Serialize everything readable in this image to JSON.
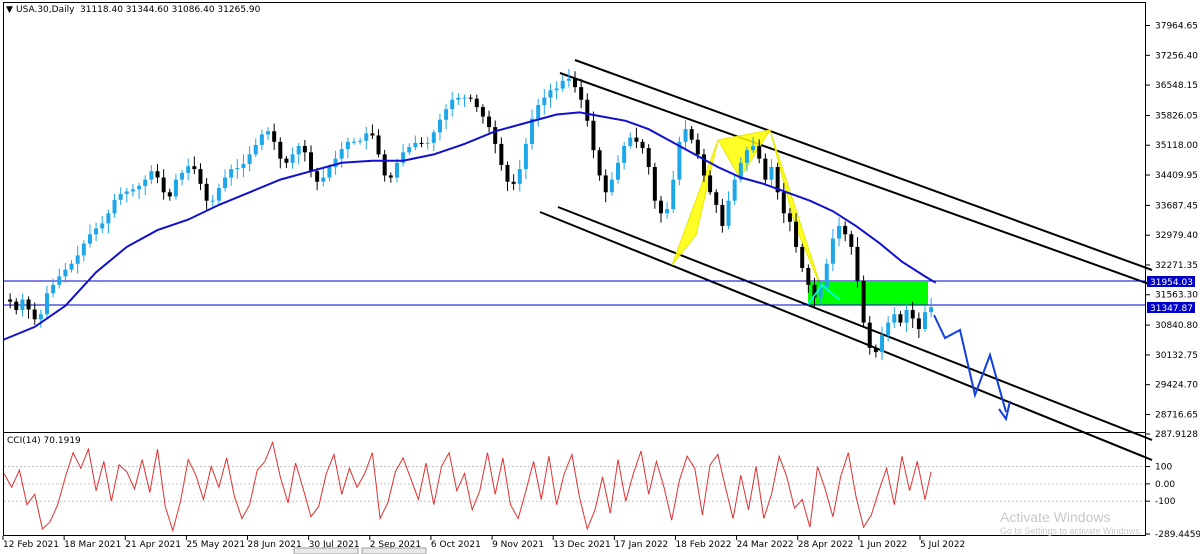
{
  "header": {
    "arrow_glyph": "▼",
    "symbol": "USA.30,Daily",
    "ohlc": "31118.40 31344.60 31086.40 31265.90"
  },
  "watermark": {
    "line1": "Activate Windows",
    "line2": "Go to Settings to activate Windows."
  },
  "colors": {
    "bull": "#1ea7e8",
    "bear": "#000000",
    "ma": "#1010d0",
    "cci": "#e03030",
    "pattern": "#ffff00",
    "zone": "#00ff00",
    "hline": "#0000c8",
    "forecast": "#1040e0",
    "channel": "#000000"
  },
  "chart_data": [
    {
      "type": "candlestick",
      "symbol": "USA.30",
      "timeframe": "Daily",
      "ylim": [
        28300,
        38500
      ],
      "y_ticks": [
        "37964.65",
        "37256.40",
        "36548.15",
        "35826.05",
        "35118.00",
        "34409.95",
        "33687.45",
        "32979.40",
        "32271.35",
        "31563.30",
        "30840.80",
        "30132.75",
        "29424.70",
        "28716.65"
      ],
      "x_ticks": [
        "12 Feb 2021",
        "18 Mar 2021",
        "21 Apr 2021",
        "25 May 2021",
        "28 Jun 2021",
        "30 Jul 2021",
        "2 Sep 2021",
        "6 Oct 2021",
        "9 Nov 2021",
        "13 Dec 2021",
        "17 Jan 2022",
        "18 Feb 2022",
        "24 Mar 2022",
        "28 Apr 2022",
        "1 Jun 2022",
        "5 Jul 2022"
      ],
      "price_path": [
        [
          0,
          31450
        ],
        [
          4,
          31400
        ],
        [
          8,
          31200
        ],
        [
          11,
          31500
        ],
        [
          15,
          31300
        ],
        [
          19,
          30950
        ],
        [
          24,
          31100
        ],
        [
          28,
          31600
        ],
        [
          33,
          31850
        ],
        [
          38,
          32100
        ],
        [
          43,
          32250
        ],
        [
          48,
          32500
        ],
        [
          53,
          32850
        ],
        [
          58,
          33100
        ],
        [
          63,
          33200
        ],
        [
          68,
          33500
        ],
        [
          73,
          33900
        ],
        [
          78,
          34000
        ],
        [
          83,
          34050
        ],
        [
          88,
          34150
        ],
        [
          92,
          34300
        ],
        [
          96,
          34500
        ],
        [
          100,
          34350
        ],
        [
          104,
          34000
        ],
        [
          108,
          33900
        ],
        [
          112,
          34300
        ],
        [
          117,
          34500
        ],
        [
          122,
          34700
        ],
        [
          126,
          34400
        ],
        [
          130,
          34000
        ],
        [
          134,
          33600
        ],
        [
          138,
          34000
        ],
        [
          142,
          34200
        ],
        [
          146,
          34500
        ],
        [
          150,
          34600
        ],
        [
          154,
          34550
        ],
        [
          158,
          34800
        ],
        [
          162,
          35000
        ],
        [
          166,
          35250
        ],
        [
          170,
          35500
        ],
        [
          174,
          35400
        ],
        [
          178,
          35000
        ],
        [
          182,
          34600
        ],
        [
          186,
          34800
        ],
        [
          190,
          35000
        ],
        [
          194,
          35200
        ],
        [
          198,
          34700
        ],
        [
          202,
          34300
        ],
        [
          206,
          34200
        ],
        [
          210,
          34500
        ],
        [
          214,
          34700
        ],
        [
          218,
          34900
        ],
        [
          222,
          35150
        ],
        [
          226,
          35250
        ],
        [
          230,
          35150
        ],
        [
          234,
          35300
        ],
        [
          238,
          35500
        ],
        [
          242,
          35200
        ],
        [
          246,
          34600
        ],
        [
          250,
          34200
        ],
        [
          254,
          34500
        ],
        [
          258,
          34900
        ],
        [
          262,
          35000
        ],
        [
          266,
          35150
        ],
        [
          270,
          35200
        ],
        [
          274,
          35100
        ],
        [
          278,
          35250
        ],
        [
          282,
          35600
        ],
        [
          286,
          35850
        ],
        [
          290,
          36100
        ],
        [
          294,
          36300
        ],
        [
          298,
          36200
        ],
        [
          302,
          36300
        ],
        [
          306,
          36150
        ],
        [
          310,
          35900
        ],
        [
          314,
          35700
        ],
        [
          318,
          35400
        ],
        [
          322,
          34900
        ],
        [
          326,
          34400
        ],
        [
          330,
          34100
        ],
        [
          334,
          34300
        ],
        [
          338,
          34800
        ],
        [
          342,
          35500
        ],
        [
          346,
          36000
        ],
        [
          350,
          36150
        ],
        [
          354,
          36350
        ],
        [
          358,
          36500
        ],
        [
          361,
          36450
        ],
        [
          364,
          36650
        ],
        [
          368,
          36700
        ],
        [
          372,
          36500
        ],
        [
          376,
          36200
        ],
        [
          380,
          35700
        ],
        [
          384,
          35000
        ],
        [
          388,
          34400
        ],
        [
          392,
          34000
        ],
        [
          396,
          34300
        ],
        [
          400,
          34700
        ],
        [
          404,
          35100
        ],
        [
          408,
          35300
        ],
        [
          412,
          35200
        ],
        [
          416,
          35050
        ],
        [
          420,
          34600
        ],
        [
          424,
          33800
        ],
        [
          428,
          33500
        ],
        [
          432,
          33600
        ],
        [
          436,
          34300
        ],
        [
          440,
          35200
        ],
        [
          444,
          35500
        ],
        [
          448,
          35250
        ],
        [
          452,
          34900
        ],
        [
          456,
          34400
        ],
        [
          460,
          34000
        ],
        [
          464,
          33700
        ],
        [
          468,
          33200
        ],
        [
          472,
          33800
        ],
        [
          476,
          34300
        ],
        [
          480,
          34700
        ],
        [
          484,
          35000
        ],
        [
          488,
          35100
        ],
        [
          492,
          34800
        ],
        [
          496,
          34300
        ],
        [
          500,
          34600
        ],
        [
          504,
          34000
        ],
        [
          508,
          33500
        ],
        [
          512,
          33300
        ],
        [
          516,
          32700
        ],
        [
          520,
          32200
        ],
        [
          524,
          31800
        ],
        [
          528,
          31500
        ],
        [
          532,
          31750
        ],
        [
          536,
          32300
        ],
        [
          540,
          32900
        ],
        [
          544,
          33200
        ],
        [
          548,
          33000
        ],
        [
          552,
          32700
        ],
        [
          556,
          31900
        ],
        [
          560,
          30900
        ],
        [
          564,
          30300
        ],
        [
          568,
          30200
        ],
        [
          572,
          30600
        ],
        [
          576,
          30900
        ],
        [
          580,
          31100
        ],
        [
          584,
          30900
        ],
        [
          588,
          31200
        ],
        [
          592,
          31000
        ],
        [
          596,
          30750
        ],
        [
          600,
          31150
        ],
        [
          604,
          31265.9
        ]
      ],
      "candles_step": 4,
      "ma_path": [
        [
          0,
          30500
        ],
        [
          20,
          30800
        ],
        [
          40,
          31300
        ],
        [
          60,
          32100
        ],
        [
          80,
          32700
        ],
        [
          100,
          33100
        ],
        [
          120,
          33350
        ],
        [
          140,
          33700
        ],
        [
          160,
          34000
        ],
        [
          180,
          34300
        ],
        [
          200,
          34500
        ],
        [
          220,
          34700
        ],
        [
          240,
          34750
        ],
        [
          260,
          34750
        ],
        [
          280,
          34900
        ],
        [
          300,
          35150
        ],
        [
          320,
          35450
        ],
        [
          340,
          35650
        ],
        [
          360,
          35850
        ],
        [
          375,
          35900
        ],
        [
          390,
          35800
        ],
        [
          405,
          35700
        ],
        [
          420,
          35500
        ],
        [
          435,
          35200
        ],
        [
          450,
          34900
        ],
        [
          465,
          34600
        ],
        [
          480,
          34350
        ],
        [
          495,
          34200
        ],
        [
          510,
          34000
        ],
        [
          525,
          33800
        ],
        [
          540,
          33550
        ],
        [
          555,
          33200
        ],
        [
          570,
          32800
        ],
        [
          585,
          32350
        ],
        [
          600,
          32000
        ],
        [
          607,
          31850
        ]
      ],
      "cci": {
        "label": "CCI(14) 70.1919",
        "ylim": [
          -289.4459,
          287.9128
        ],
        "y_ticks": [
          "287.9128",
          "100",
          "0.00",
          "-100",
          "-289.4459"
        ],
        "path": [
          [
            0,
            60
          ],
          [
            5,
            -20
          ],
          [
            10,
            80
          ],
          [
            15,
            -120
          ],
          [
            20,
            -60
          ],
          [
            25,
            -260
          ],
          [
            30,
            -220
          ],
          [
            35,
            -120
          ],
          [
            40,
            40
          ],
          [
            45,
            180
          ],
          [
            50,
            90
          ],
          [
            55,
            200
          ],
          [
            60,
            -40
          ],
          [
            65,
            130
          ],
          [
            70,
            -100
          ],
          [
            75,
            110
          ],
          [
            80,
            70
          ],
          [
            85,
            -30
          ],
          [
            90,
            140
          ],
          [
            95,
            -50
          ],
          [
            100,
            200
          ],
          [
            105,
            -130
          ],
          [
            110,
            -270
          ],
          [
            115,
            -100
          ],
          [
            120,
            140
          ],
          [
            125,
            50
          ],
          [
            130,
            -90
          ],
          [
            135,
            100
          ],
          [
            140,
            -20
          ],
          [
            145,
            150
          ],
          [
            150,
            -70
          ],
          [
            155,
            -200
          ],
          [
            160,
            -120
          ],
          [
            165,
            80
          ],
          [
            170,
            130
          ],
          [
            175,
            240
          ],
          [
            180,
            40
          ],
          [
            185,
            -110
          ],
          [
            190,
            120
          ],
          [
            195,
            -30
          ],
          [
            200,
            -190
          ],
          [
            205,
            -130
          ],
          [
            210,
            60
          ],
          [
            215,
            170
          ],
          [
            220,
            -60
          ],
          [
            225,
            90
          ],
          [
            230,
            -20
          ],
          [
            235,
            60
          ],
          [
            240,
            180
          ],
          [
            245,
            -200
          ],
          [
            250,
            -110
          ],
          [
            255,
            70
          ],
          [
            260,
            150
          ],
          [
            265,
            30
          ],
          [
            270,
            -90
          ],
          [
            275,
            120
          ],
          [
            280,
            -120
          ],
          [
            285,
            100
          ],
          [
            290,
            180
          ],
          [
            295,
            -40
          ],
          [
            300,
            60
          ],
          [
            305,
            -150
          ],
          [
            310,
            -40
          ],
          [
            315,
            180
          ],
          [
            320,
            -60
          ],
          [
            325,
            150
          ],
          [
            330,
            -120
          ],
          [
            335,
            -200
          ],
          [
            340,
            -40
          ],
          [
            345,
            130
          ],
          [
            350,
            -90
          ],
          [
            355,
            160
          ],
          [
            360,
            -120
          ],
          [
            365,
            60
          ],
          [
            370,
            170
          ],
          [
            375,
            -80
          ],
          [
            380,
            -260
          ],
          [
            385,
            -150
          ],
          [
            390,
            40
          ],
          [
            395,
            -170
          ],
          [
            400,
            140
          ],
          [
            405,
            -100
          ],
          [
            410,
            60
          ],
          [
            415,
            190
          ],
          [
            420,
            -60
          ],
          [
            425,
            130
          ],
          [
            430,
            -20
          ],
          [
            435,
            -210
          ],
          [
            440,
            20
          ],
          [
            445,
            160
          ],
          [
            450,
            90
          ],
          [
            455,
            -180
          ],
          [
            460,
            110
          ],
          [
            465,
            170
          ],
          [
            470,
            -20
          ],
          [
            475,
            -200
          ],
          [
            480,
            50
          ],
          [
            485,
            -150
          ],
          [
            490,
            100
          ],
          [
            495,
            -200
          ],
          [
            500,
            -60
          ],
          [
            505,
            160
          ],
          [
            510,
            40
          ],
          [
            515,
            -140
          ],
          [
            520,
            -90
          ],
          [
            525,
            -250
          ],
          [
            530,
            100
          ],
          [
            535,
            -30
          ],
          [
            540,
            -190
          ],
          [
            545,
            40
          ],
          [
            550,
            180
          ],
          [
            555,
            -70
          ],
          [
            560,
            -250
          ],
          [
            565,
            -180
          ],
          [
            570,
            -40
          ],
          [
            575,
            90
          ],
          [
            580,
            -120
          ],
          [
            585,
            160
          ],
          [
            590,
            -40
          ],
          [
            595,
            130
          ],
          [
            600,
            -90
          ],
          [
            604,
            70
          ]
        ]
      }
    }
  ]
}
